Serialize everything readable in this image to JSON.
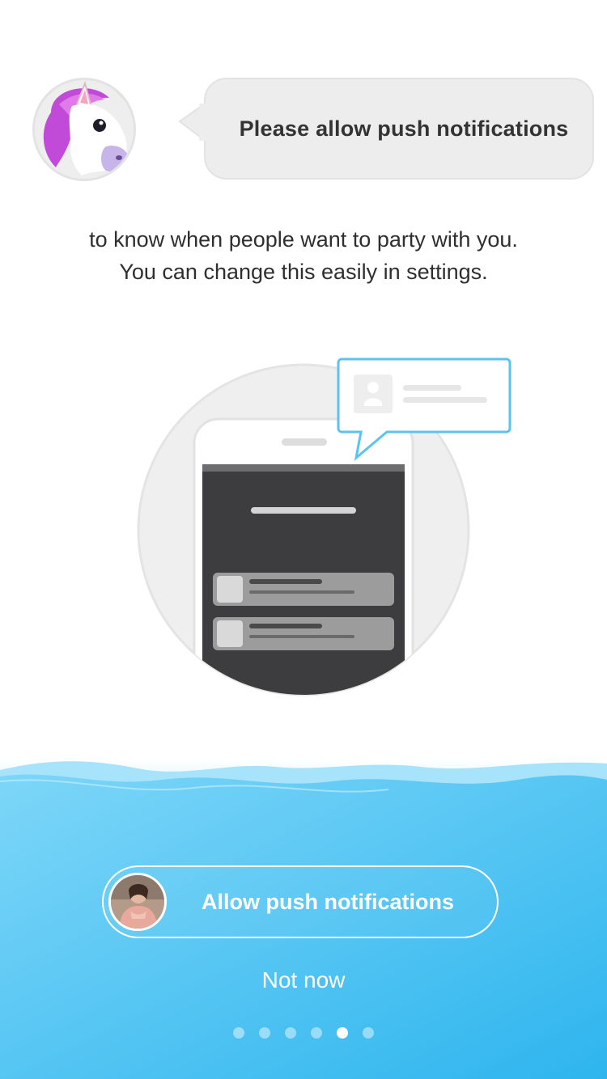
{
  "header": {
    "avatar_icon": "unicorn-face-icon",
    "bubble_text": "Please allow push notifications"
  },
  "description": {
    "line1": "to know when people want to party with you.",
    "line2": "You can change this easily in settings."
  },
  "illustration": {
    "icon": "phone-notification-illustration"
  },
  "actions": {
    "allow_label": "Allow push notifications",
    "allow_avatar_icon": "user-photo-avatar",
    "not_now_label": "Not now"
  },
  "pagination": {
    "total": 6,
    "active_index": 4
  },
  "colors": {
    "wave_light": "#7dd6f8",
    "wave_dark": "#2eb5ee",
    "bubble_bg": "#ededed",
    "text_dark": "#333333"
  }
}
